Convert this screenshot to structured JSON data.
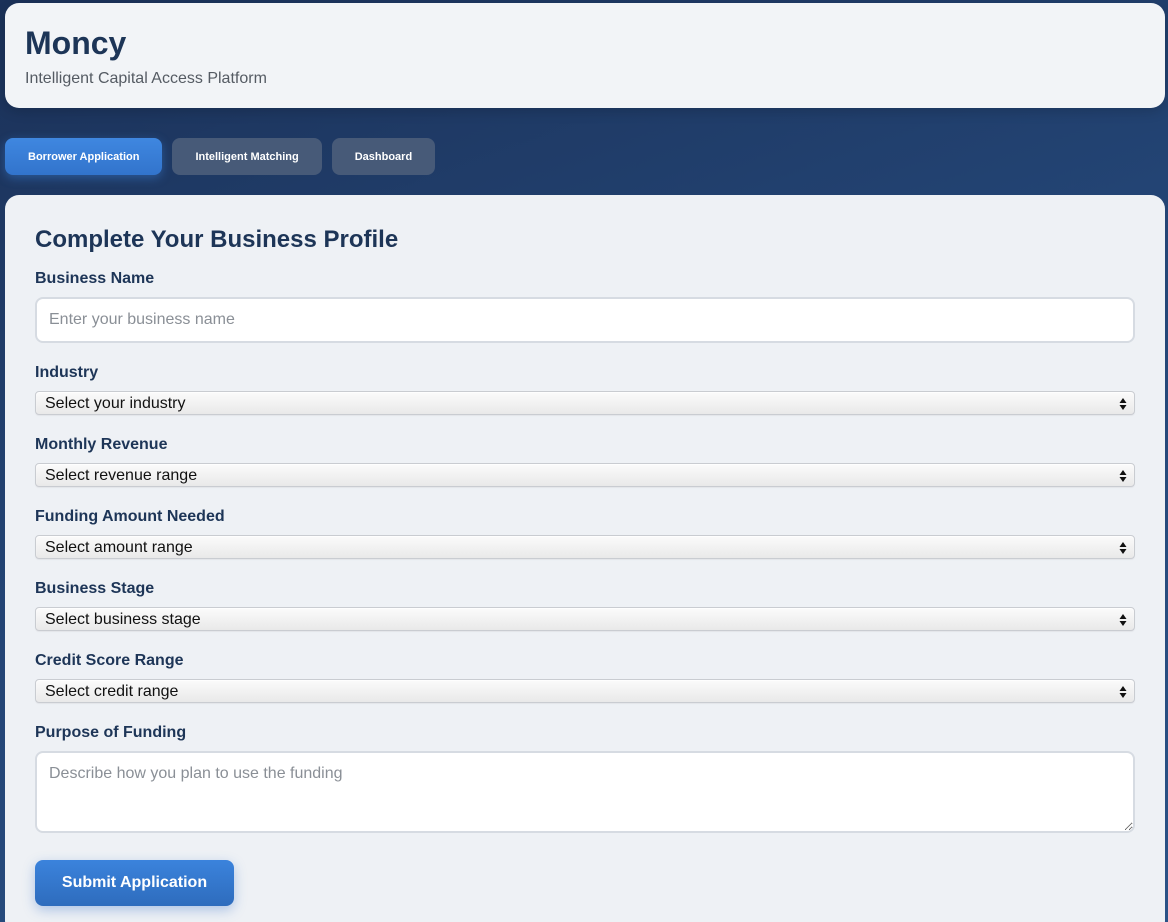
{
  "header": {
    "title": "Moncy",
    "subtitle": "Intelligent Capital Access Platform"
  },
  "tabs": [
    {
      "label": "Borrower Application",
      "active": true
    },
    {
      "label": "Intelligent Matching",
      "active": false
    },
    {
      "label": "Dashboard",
      "active": false
    }
  ],
  "form": {
    "heading": "Complete Your Business Profile",
    "business_name": {
      "label": "Business Name",
      "value": "",
      "placeholder": "Enter your business name"
    },
    "industry": {
      "label": "Industry",
      "selected": "Select your industry"
    },
    "monthly_revenue": {
      "label": "Monthly Revenue",
      "selected": "Select revenue range"
    },
    "funding_amount": {
      "label": "Funding Amount Needed",
      "selected": "Select amount range"
    },
    "business_stage": {
      "label": "Business Stage",
      "selected": "Select business stage"
    },
    "credit_score": {
      "label": "Credit Score Range",
      "selected": "Select credit range"
    },
    "purpose": {
      "label": "Purpose of Funding",
      "value": "",
      "placeholder": "Describe how you plan to use the funding"
    },
    "submit_label": "Submit Application"
  },
  "colors": {
    "brand_dark": "#1d3557",
    "accent": "#3b83dc",
    "tab_inactive": "#475a78"
  },
  "icons": {
    "select_arrow": "up-down-chevron-icon"
  }
}
